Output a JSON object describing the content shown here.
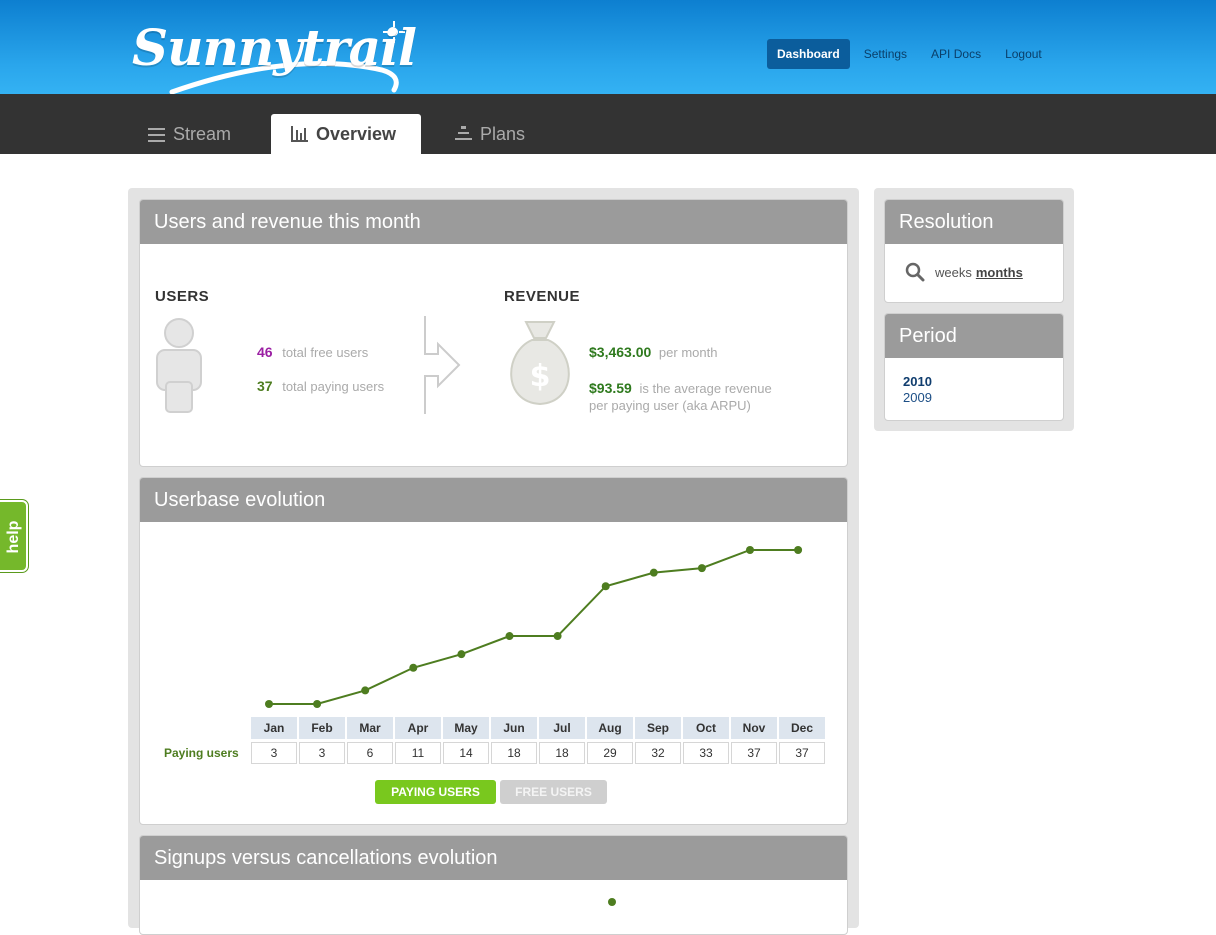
{
  "brand": {
    "name": "Sunnytrail"
  },
  "topnav": [
    {
      "label": "Dashboard",
      "active": true
    },
    {
      "label": "Settings",
      "active": false
    },
    {
      "label": "API Docs",
      "active": false
    },
    {
      "label": "Logout",
      "active": false
    }
  ],
  "tabs": [
    {
      "label": "Stream",
      "icon": "list-icon",
      "active": false
    },
    {
      "label": "Overview",
      "icon": "bar-chart-icon",
      "active": true
    },
    {
      "label": "Plans",
      "icon": "plans-icon",
      "active": false
    }
  ],
  "summary": {
    "title": "Users and revenue this month",
    "users_heading": "USERS",
    "free_users": "46",
    "free_users_label": "total free users",
    "paying_users": "37",
    "paying_users_label": "total paying users",
    "revenue_heading": "REVENUE",
    "monthly_revenue": "$3,463.00",
    "monthly_revenue_label": "per month",
    "arpu": "$93.59",
    "arpu_label_1": "is the average revenue",
    "arpu_label_2": "per paying user (aka ARPU)",
    "colors": {
      "free": "#9b1fa3",
      "paying": "#4e7d20",
      "revenue": "#2f7a1e"
    }
  },
  "userbase": {
    "title": "Userbase evolution",
    "row_label": "Paying users",
    "toggle_on": "PAYING USERS",
    "toggle_off": "FREE USERS"
  },
  "chart_data": {
    "type": "line",
    "categories": [
      "Jan",
      "Feb",
      "Mar",
      "Apr",
      "May",
      "Jun",
      "Jul",
      "Aug",
      "Sep",
      "Oct",
      "Nov",
      "Dec"
    ],
    "series": [
      {
        "name": "Paying users",
        "values": [
          3,
          3,
          6,
          11,
          14,
          18,
          18,
          29,
          32,
          33,
          37,
          37
        ],
        "color": "#4e7d20"
      }
    ],
    "ylim": [
      3,
      37
    ],
    "grid": false
  },
  "signups": {
    "title": "Signups versus cancellations evolution"
  },
  "sidebar": {
    "resolution_title": "Resolution",
    "resolution_options": [
      {
        "label": "weeks",
        "selected": false
      },
      {
        "label": "months",
        "selected": true
      }
    ],
    "period_title": "Period",
    "years": [
      {
        "label": "2010",
        "selected": true
      },
      {
        "label": "2009",
        "selected": false
      }
    ]
  },
  "help": {
    "label": "help"
  }
}
